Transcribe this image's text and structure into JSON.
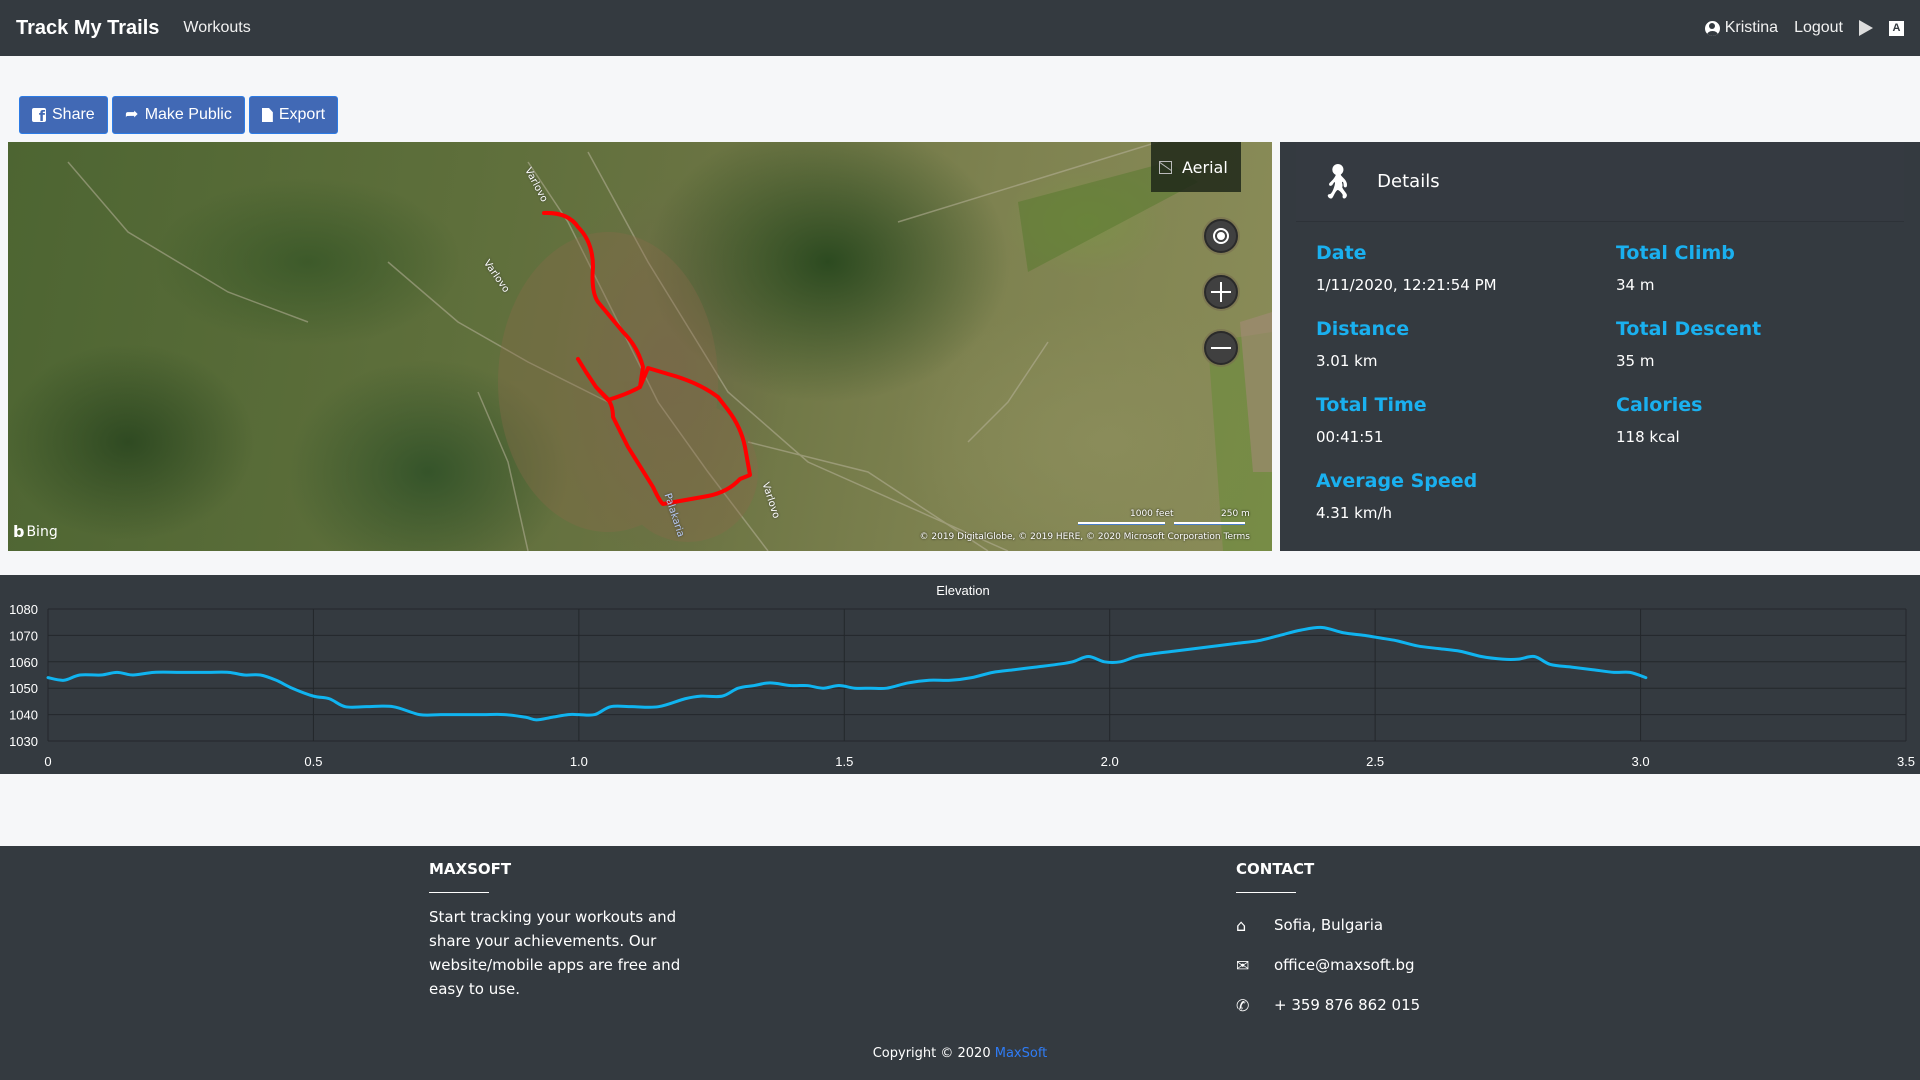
{
  "navbar": {
    "brand": "Track My Trails",
    "links": [
      {
        "label": "Workouts"
      }
    ],
    "user": {
      "icon": "user-circle-icon",
      "name": "Kristina"
    },
    "logout_label": "Logout",
    "store_icons": [
      "google-play-icon",
      "app-store-icon"
    ]
  },
  "actions": {
    "share": {
      "label": "Share",
      "icon": "facebook-icon"
    },
    "make_public": {
      "label": "Make Public",
      "icon": "share-arrow-icon"
    },
    "export": {
      "label": "Export",
      "icon": "file-export-icon"
    }
  },
  "map": {
    "layer_button": "Aerial",
    "controls": [
      "locate-me",
      "zoom-in",
      "zoom-out"
    ],
    "provider": "Bing",
    "scale_labels": [
      "1000 feet",
      "250 m"
    ],
    "attribution": "© 2019 DigitalGlobe, © 2019 HERE, © 2020 Microsoft Corporation  Terms",
    "street_labels": [
      "Varlovo",
      "Varlovo",
      "Palakaria",
      "Varlovo"
    ],
    "route_color": "#ff0000"
  },
  "details": {
    "title": "Details",
    "activity_icon": "walking-icon",
    "stats": [
      {
        "label": "Date",
        "value": "1/11/2020, 12:21:54 PM"
      },
      {
        "label": "Total Climb",
        "value": "34 m"
      },
      {
        "label": "Distance",
        "value": "3.01 km"
      },
      {
        "label": "Total Descent",
        "value": "35 m"
      },
      {
        "label": "Total Time",
        "value": "00:41:51"
      },
      {
        "label": "Calories",
        "value": "118 kcal"
      },
      {
        "label": "Average Speed",
        "value": "4.31 km/h"
      }
    ],
    "accent_color": "#1ab0ef"
  },
  "chart_data": {
    "type": "line",
    "title": "Elevation",
    "xlabel": "",
    "ylabel": "",
    "xlim": [
      0,
      3.5
    ],
    "ylim": [
      1030,
      1080
    ],
    "x_ticks": [
      "0",
      "0.5",
      "1.0",
      "1.5",
      "2.0",
      "2.5",
      "3.0",
      "3.5"
    ],
    "y_ticks": [
      "1080",
      "1070",
      "1060",
      "1050",
      "1040",
      "1030"
    ],
    "grid": true,
    "legend": "none",
    "series": [
      {
        "name": "Elevation",
        "color": "#10b4f0",
        "x": [
          0,
          0.03,
          0.06,
          0.1,
          0.13,
          0.16,
          0.2,
          0.25,
          0.3,
          0.34,
          0.37,
          0.4,
          0.43,
          0.46,
          0.5,
          0.53,
          0.56,
          0.6,
          0.65,
          0.7,
          0.74,
          0.78,
          0.82,
          0.86,
          0.9,
          0.92,
          0.95,
          0.98,
          1.0,
          1.03,
          1.06,
          1.1,
          1.15,
          1.2,
          1.23,
          1.27,
          1.3,
          1.33,
          1.36,
          1.4,
          1.43,
          1.46,
          1.49,
          1.52,
          1.55,
          1.58,
          1.62,
          1.66,
          1.7,
          1.74,
          1.78,
          1.82,
          1.86,
          1.9,
          1.93,
          1.96,
          1.99,
          2.02,
          2.05,
          2.08,
          2.12,
          2.16,
          2.2,
          2.24,
          2.28,
          2.32,
          2.36,
          2.4,
          2.44,
          2.48,
          2.51,
          2.54,
          2.58,
          2.62,
          2.66,
          2.7,
          2.74,
          2.77,
          2.8,
          2.83,
          2.87,
          2.91,
          2.95,
          2.98,
          3.01
        ],
        "y": [
          1054,
          1053,
          1055,
          1055,
          1056,
          1055,
          1056,
          1056,
          1056,
          1056,
          1055,
          1055,
          1053,
          1050,
          1047,
          1046,
          1043,
          1043,
          1043,
          1040,
          1040,
          1040,
          1040,
          1040,
          1039,
          1038,
          1039,
          1040,
          1040,
          1040,
          1043,
          1043,
          1043,
          1046,
          1047,
          1047,
          1050,
          1051,
          1052,
          1051,
          1051,
          1050,
          1051,
          1050,
          1050,
          1050,
          1052,
          1053,
          1053,
          1054,
          1056,
          1057,
          1058,
          1059,
          1060,
          1062,
          1060,
          1060,
          1062,
          1063,
          1064,
          1065,
          1066,
          1067,
          1068,
          1070,
          1072,
          1073,
          1071,
          1070,
          1069,
          1068,
          1066,
          1065,
          1064,
          1062,
          1061,
          1061,
          1062,
          1059,
          1058,
          1057,
          1056,
          1056,
          1054
        ]
      }
    ]
  },
  "footer": {
    "about": {
      "title": "MAXSOFT",
      "text": "Start tracking your workouts and share your achievements. Our website/mobile apps are free and easy to use."
    },
    "contact": {
      "title": "CONTACT",
      "items": [
        {
          "icon": "home-icon",
          "text": "Sofia, Bulgaria"
        },
        {
          "icon": "envelope-icon",
          "text": "office@maxsoft.bg"
        },
        {
          "icon": "phone-icon",
          "text": "+ 359 876 862 015"
        }
      ]
    },
    "copyright_prefix": "Copyright © 2020",
    "copyright_link": "MaxSoft",
    "link_color": "#2f7cf6"
  }
}
